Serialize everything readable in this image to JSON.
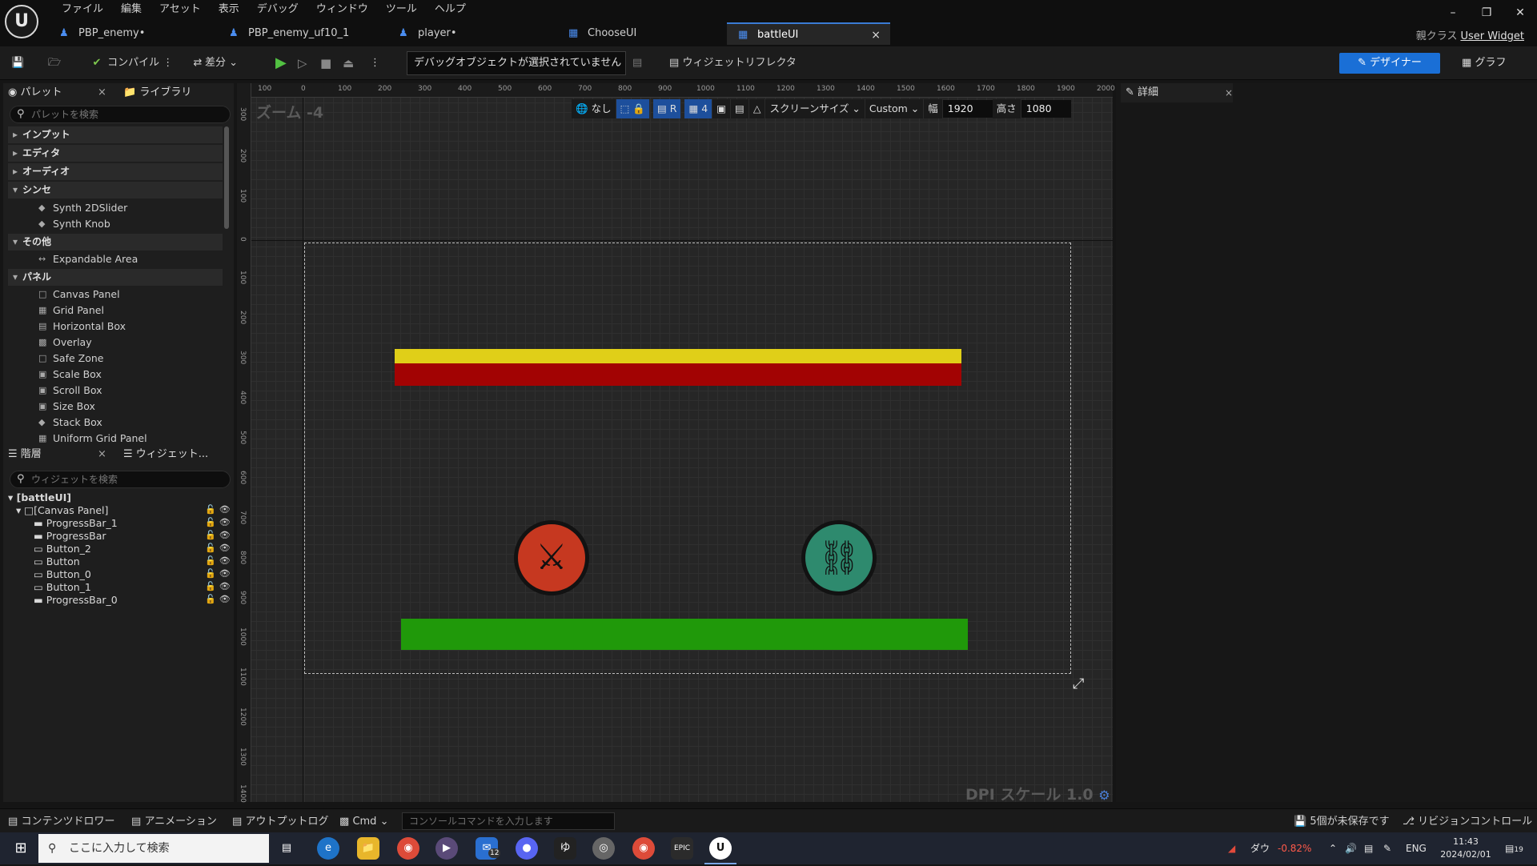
{
  "menu": [
    "ファイル",
    "編集",
    "アセット",
    "表示",
    "デバッグ",
    "ウィンドウ",
    "ツール",
    "ヘルプ"
  ],
  "tabs": [
    {
      "label": "PBP_enemy•",
      "active": false
    },
    {
      "label": "PBP_enemy_uf10_1",
      "active": false
    },
    {
      "label": "player•",
      "active": false
    },
    {
      "label": "ChooseUI",
      "active": false
    },
    {
      "label": "battleUI",
      "active": true
    }
  ],
  "parent_class": {
    "label": "親クラス",
    "value": "User Widget"
  },
  "toolbar": {
    "compile": "コンパイル",
    "diff": "差分",
    "debug_object": "デバッグオブジェクトが選択されていません",
    "widget_reflector": "ウィジェットリフレクタ",
    "designer": "デザイナー",
    "graph": "グラフ"
  },
  "palette": {
    "tab_palette": "パレット",
    "tab_library": "ライブラリ",
    "search_placeholder": "パレットを検索",
    "categories": {
      "input": "インプット",
      "editor": "エディタ",
      "audio": "オーディオ",
      "synth": "シンセ",
      "other": "その他",
      "panel": "パネル"
    },
    "synth_items": [
      "Synth 2DSlider",
      "Synth Knob"
    ],
    "other_items": [
      "Expandable Area"
    ],
    "panel_items": [
      "Canvas Panel",
      "Grid Panel",
      "Horizontal Box",
      "Overlay",
      "Safe Zone",
      "Scale Box",
      "Scroll Box",
      "Size Box",
      "Stack Box",
      "Uniform Grid Panel"
    ]
  },
  "hierarchy": {
    "tab_hierarchy": "階層",
    "tab_widget": "ウィジェット...",
    "search_placeholder": "ウィジェットを検索",
    "root": "[battleUI]",
    "canvas": "[Canvas Panel]",
    "children": [
      "ProgressBar_1",
      "ProgressBar",
      "Button_2",
      "Button",
      "Button_0",
      "Button_1",
      "ProgressBar_0"
    ]
  },
  "viewport": {
    "zoom": "ズーム -4",
    "none": "なし",
    "r_label": "R",
    "grid_size": "4",
    "screen_size": "スクリーンサイズ",
    "preset": "Custom",
    "width_label": "幅",
    "width": "1920",
    "height_label": "高さ",
    "height": "1080",
    "dpi": "DPI スケール 1.0",
    "ruler_top": [
      "100",
      "0",
      "100",
      "200",
      "300",
      "400",
      "500",
      "600",
      "700",
      "800",
      "900",
      "1000",
      "1100",
      "1200",
      "1300",
      "1400",
      "1500",
      "1600",
      "1700",
      "1800",
      "1900",
      "2000"
    ],
    "ruler_left": [
      "300",
      "200",
      "100",
      "0",
      "100",
      "200",
      "300",
      "400",
      "500",
      "600",
      "700",
      "800",
      "900",
      "1000",
      "1100",
      "1200",
      "1300",
      "1400"
    ]
  },
  "canvas_widgets": {
    "enemy_hp": 1.0,
    "player_hp": 1.0,
    "colors": {
      "yellow": "#d9c800",
      "red": "#9a0000",
      "green": "#1e9600",
      "attack": "#c63820",
      "defend": "#2e8a6e"
    }
  },
  "details": {
    "title": "詳細"
  },
  "bottom": {
    "content_drawer": "コンテンツドロワー",
    "animation": "アニメーション",
    "output_log": "アウトプットログ",
    "cmd": "Cmd",
    "console_placeholder": "コンソールコマンドを入力します",
    "unsaved": "5個が未保存です",
    "revision_control": "リビジョンコントロール"
  },
  "taskbar": {
    "search_placeholder": "ここに入力して検索",
    "stock_label": "ダウ",
    "stock_change": "-0.82%",
    "lang": "ENG",
    "time": "11:43",
    "date": "2024/02/01",
    "notifications": "19",
    "mail_badge": "12"
  }
}
